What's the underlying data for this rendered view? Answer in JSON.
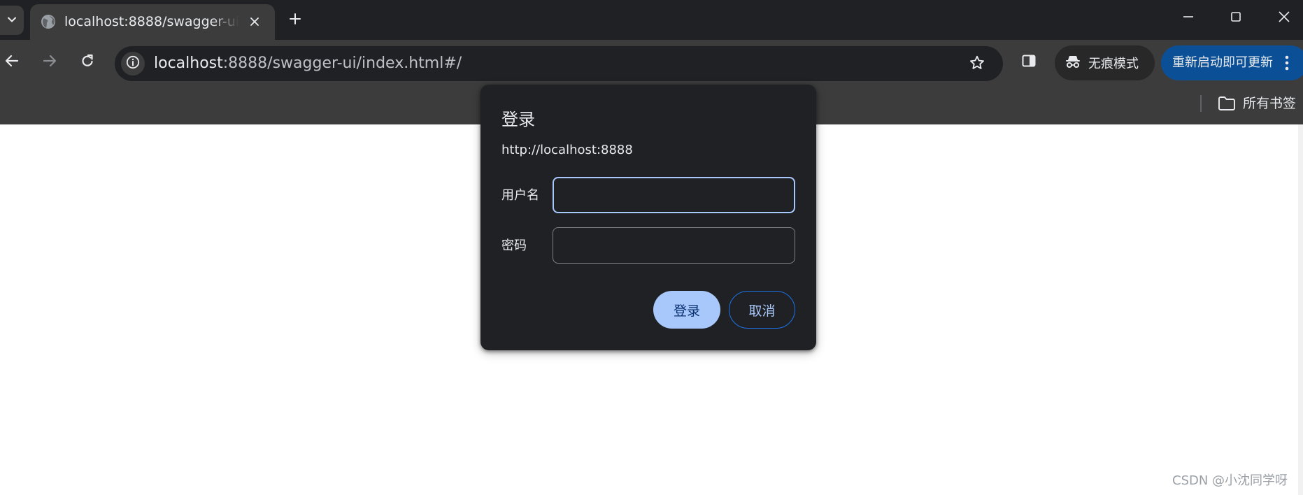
{
  "tab": {
    "title": "localhost:8888/swagger-ui/index.html#/"
  },
  "address_bar": {
    "host": "localhost",
    "path": ":8888/swagger-ui/index.html#/"
  },
  "toolbar": {
    "incognito_label": "无痕模式",
    "relaunch_label": "重新启动即可更新"
  },
  "bookmarks_bar": {
    "all_bookmarks_label": "所有书签"
  },
  "auth_dialog": {
    "title": "登录",
    "origin": "http://localhost:8888",
    "username_label": "用户名",
    "username_value": "",
    "password_label": "密码",
    "password_value": "",
    "login_button": "登录",
    "cancel_button": "取消"
  },
  "watermark": "CSDN @小沈同学呀",
  "colors": {
    "tabstrip_bg": "#202124",
    "toolbar_bg": "#3c3c3c",
    "accent": "#a8c7fa",
    "relaunch_bg": "#0b5096"
  },
  "icons": {
    "tab_search": "chevron-down-icon",
    "tab_favicon": "globe-icon",
    "tab_close": "close-icon",
    "new_tab": "plus-icon",
    "back": "arrow-left-icon",
    "forward": "arrow-right-icon",
    "reload": "reload-icon",
    "site_info": "info-icon",
    "bookmark": "star-icon",
    "side_panel": "side-panel-icon",
    "incognito": "incognito-icon",
    "menu": "kebab-icon",
    "folder": "folder-icon"
  }
}
